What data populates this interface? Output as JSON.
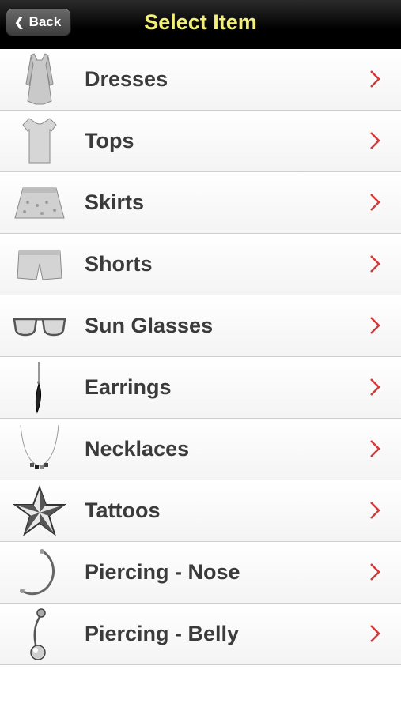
{
  "navbar": {
    "back_label": "Back",
    "title": "Select Item"
  },
  "items": [
    {
      "label": "Dresses",
      "icon": "dress-icon"
    },
    {
      "label": "Tops",
      "icon": "top-icon"
    },
    {
      "label": "Skirts",
      "icon": "skirt-icon"
    },
    {
      "label": "Shorts",
      "icon": "shorts-icon"
    },
    {
      "label": "Sun Glasses",
      "icon": "sunglasses-icon"
    },
    {
      "label": "Earrings",
      "icon": "earring-icon"
    },
    {
      "label": "Necklaces",
      "icon": "necklace-icon"
    },
    {
      "label": "Tattoos",
      "icon": "star-tattoo-icon"
    },
    {
      "label": "Piercing - Nose",
      "icon": "nose-ring-icon"
    },
    {
      "label": "Piercing - Belly",
      "icon": "belly-ring-icon"
    }
  ],
  "colors": {
    "title": "#f2ef7a",
    "arrow": "#d23a3a",
    "navbar": "#000000"
  }
}
